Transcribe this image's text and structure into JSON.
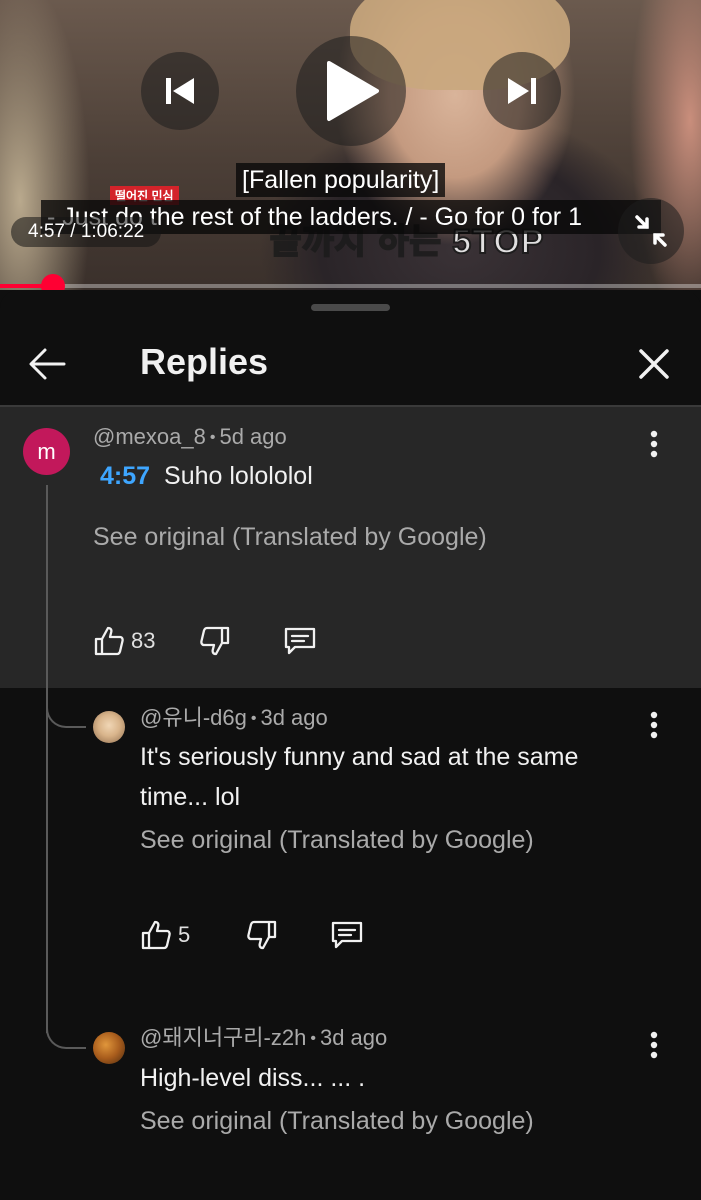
{
  "video": {
    "caption_line1": "[Fallen popularity]",
    "caption_line2": "- Just do the rest of the ladders. / - Go for 0 for 1",
    "promo_tag": "떨어진 민심",
    "promo_big": "끝까지 하는 5TOP",
    "time_display": "4:57 / 1:06:22",
    "progress_fraction": 0.075,
    "icons": [
      "previous-icon",
      "play-icon",
      "next-icon",
      "fullscreen-exit-icon"
    ]
  },
  "sheet": {
    "title": "Replies",
    "back_icon": "arrow-left-icon",
    "close_icon": "close-icon"
  },
  "comments": [
    {
      "avatar_letter": "m",
      "avatar_color": "#c2185b",
      "handle": "@mexoa_8",
      "age": "5d ago",
      "timestamp": "4:57",
      "text": "Suho lolololol",
      "translate_label": "See original (Translated by Google)",
      "likes": "83"
    },
    {
      "handle": "@유니-d6g",
      "age": "3d ago",
      "text": "It's seriously funny and sad at the same time... lol",
      "translate_label": "See original (Translated by Google)",
      "likes": "5"
    },
    {
      "handle": "@돼지너구리-z2h",
      "age": "3d ago",
      "text": "High-level diss... ... .",
      "translate_label": "See original (Translated by Google)"
    }
  ],
  "colors": {
    "accent_link": "#3ea6ff",
    "progress": "#ff0033",
    "sheet_bg": "#0f0f0f",
    "highlight_bg": "#272727"
  }
}
